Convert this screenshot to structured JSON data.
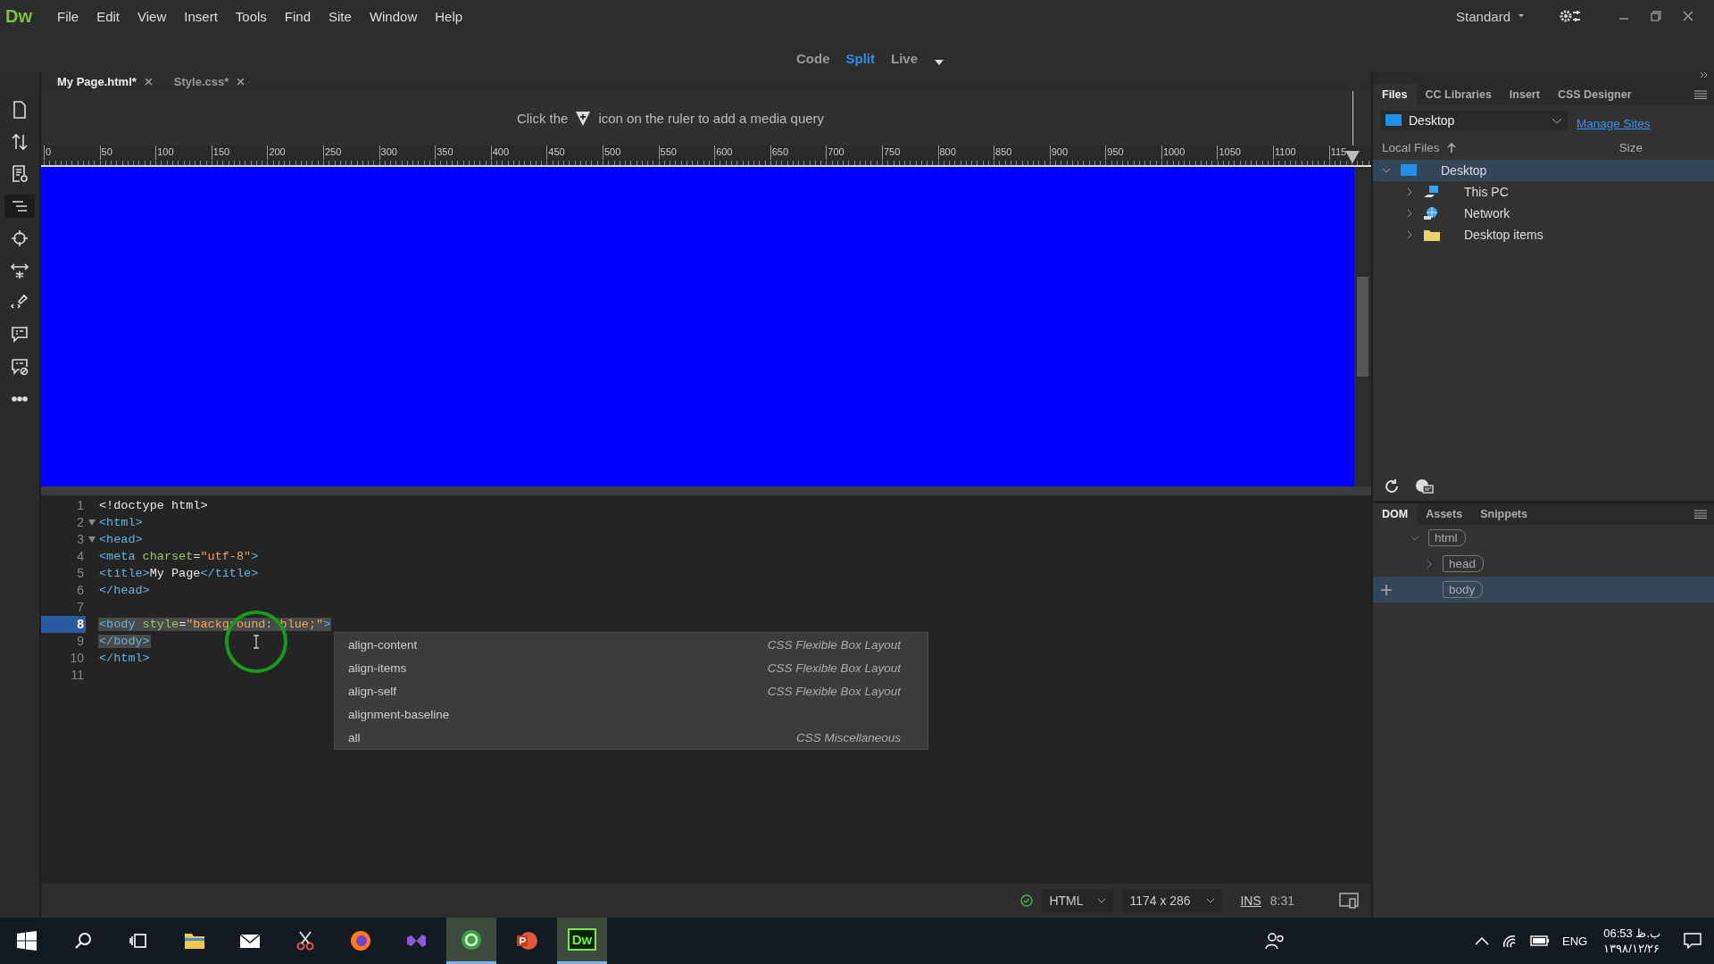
{
  "app_logo": "Dw",
  "menu": [
    "File",
    "Edit",
    "View",
    "Insert",
    "Tools",
    "Find",
    "Site",
    "Window",
    "Help"
  ],
  "workspace": "Standard",
  "view_switcher": [
    {
      "label": "Code",
      "selected": false
    },
    {
      "label": "Split",
      "selected": true
    },
    {
      "label": "Live",
      "selected": false
    }
  ],
  "document_tabs": [
    {
      "label": "My Page.html*",
      "selected": true
    },
    {
      "label": "Style.css*",
      "selected": false
    }
  ],
  "left_toolbar": [
    {
      "kind": "file",
      "selected": false
    },
    {
      "kind": "transfer",
      "selected": false
    },
    {
      "kind": "preview",
      "selected": false
    },
    {
      "kind": "outline",
      "selected": true
    },
    {
      "kind": "target",
      "selected": false
    },
    {
      "kind": "expand",
      "selected": false
    },
    {
      "kind": "brush",
      "selected": false
    },
    {
      "kind": "comment",
      "selected": false
    },
    {
      "kind": "comment-off",
      "selected": false
    },
    {
      "kind": "more",
      "selected": false
    }
  ],
  "media_query_hint": {
    "before": "Click the",
    "after": "icon on the ruler to add a media query"
  },
  "ruler_marks": [
    "0",
    "50",
    "100",
    "150",
    "200",
    "250",
    "300",
    "350",
    "400",
    "450",
    "500",
    "550",
    "600",
    "650",
    "700",
    "750",
    "800",
    "850",
    "900",
    "950",
    "1000",
    "1050",
    "1100",
    "115"
  ],
  "code_lines": [
    {
      "number": "1",
      "fold": false,
      "selected": false,
      "tokens": [
        {
          "kind": "plain",
          "text": "<!doctype html>"
        }
      ]
    },
    {
      "number": "2",
      "fold": true,
      "selected": false,
      "tokens": [
        {
          "kind": "tag",
          "text": "<html>"
        }
      ]
    },
    {
      "number": "3",
      "fold": true,
      "selected": false,
      "tokens": [
        {
          "kind": "tag",
          "text": "<head>"
        }
      ]
    },
    {
      "number": "4",
      "fold": false,
      "selected": false,
      "tokens": [
        {
          "kind": "tag",
          "text": "<meta "
        },
        {
          "kind": "attr",
          "text": "charset"
        },
        {
          "kind": "plain",
          "text": "="
        },
        {
          "kind": "value",
          "text": "\"utf-8\""
        },
        {
          "kind": "tag",
          "text": ">"
        }
      ]
    },
    {
      "number": "5",
      "fold": false,
      "selected": false,
      "tokens": [
        {
          "kind": "tag",
          "text": "<title>"
        },
        {
          "kind": "plain",
          "text": "My Page"
        },
        {
          "kind": "tag",
          "text": "</title>"
        }
      ]
    },
    {
      "number": "6",
      "fold": false,
      "selected": false,
      "tokens": [
        {
          "kind": "tag",
          "text": "</head>"
        }
      ]
    },
    {
      "number": "7",
      "fold": false,
      "selected": false
    },
    {
      "number": "8",
      "fold": false,
      "selected": true,
      "current": true,
      "tokens": [
        {
          "kind": "tag",
          "text": "<body "
        },
        {
          "kind": "attr",
          "text": "style"
        },
        {
          "kind": "plain",
          "text": "="
        },
        {
          "kind": "value",
          "text": "\"background: blue;\""
        },
        {
          "kind": "tag",
          "text": ">"
        }
      ]
    },
    {
      "number": "9",
      "fold": false,
      "selected": true,
      "tokens": [
        {
          "kind": "tag",
          "text": "</body>"
        }
      ]
    },
    {
      "number": "10",
      "fold": false,
      "selected": false,
      "tokens": [
        {
          "kind": "tag",
          "text": "</html>"
        }
      ]
    },
    {
      "number": "11",
      "fold": false,
      "selected": false
    }
  ],
  "code_hints": [
    {
      "label": "align-content",
      "category": "CSS Flexible Box Layout"
    },
    {
      "label": "align-items",
      "category": "CSS Flexible Box Layout"
    },
    {
      "label": "align-self",
      "category": "CSS Flexible Box Layout"
    },
    {
      "label": "alignment-baseline"
    },
    {
      "label": "all",
      "category": "CSS Miscellaneous"
    }
  ],
  "status_bar": {
    "language": "HTML",
    "size": "1174 x 286",
    "mode": "INS",
    "position": "8:31"
  },
  "files_panel": {
    "tabs": [
      {
        "label": "Files",
        "selected": true
      },
      {
        "label": "CC Libraries",
        "selected": false
      },
      {
        "label": "Insert",
        "selected": false
      },
      {
        "label": "CSS Designer",
        "selected": false
      }
    ],
    "site": "Desktop",
    "manage_link": "Manage Sites",
    "columns": [
      "Local Files",
      "Size"
    ],
    "tree": [
      {
        "label": "Desktop",
        "kind": "desktop",
        "expanded": true,
        "selected": true,
        "children": [
          {
            "label": "This PC",
            "kind": "pc",
            "expanded": false,
            "selected": false
          },
          {
            "label": "Network",
            "kind": "network",
            "expanded": false,
            "selected": false
          },
          {
            "label": "Desktop items",
            "kind": "folder",
            "expanded": false,
            "selected": false
          }
        ]
      }
    ]
  },
  "dom_panel": {
    "tabs": [
      {
        "label": "DOM",
        "selected": true
      },
      {
        "label": "Assets",
        "selected": false
      },
      {
        "label": "Snippets",
        "selected": false
      }
    ],
    "tree": [
      {
        "label": "html",
        "expanded": true,
        "selected": false,
        "children": [
          {
            "label": "head",
            "expanded": false,
            "selected": false
          },
          {
            "label": "body",
            "selected": true
          }
        ]
      }
    ]
  },
  "taskbar": {
    "apps": [
      {
        "kind": "search",
        "active": false
      },
      {
        "kind": "taskview",
        "active": false
      },
      {
        "kind": "explorer",
        "active": false
      },
      {
        "kind": "mail",
        "active": false
      },
      {
        "kind": "snip",
        "active": false
      },
      {
        "kind": "firefox",
        "active": false
      },
      {
        "kind": "vs",
        "active": false
      },
      {
        "kind": "green",
        "active": true
      },
      {
        "kind": "ppt",
        "active": false
      },
      {
        "kind": "dw",
        "active": true,
        "label": "Dw"
      }
    ],
    "language": "ENG",
    "time": "06:53 ب.ظ",
    "date": "۱۳۹۸/۱۲/۲۶"
  }
}
